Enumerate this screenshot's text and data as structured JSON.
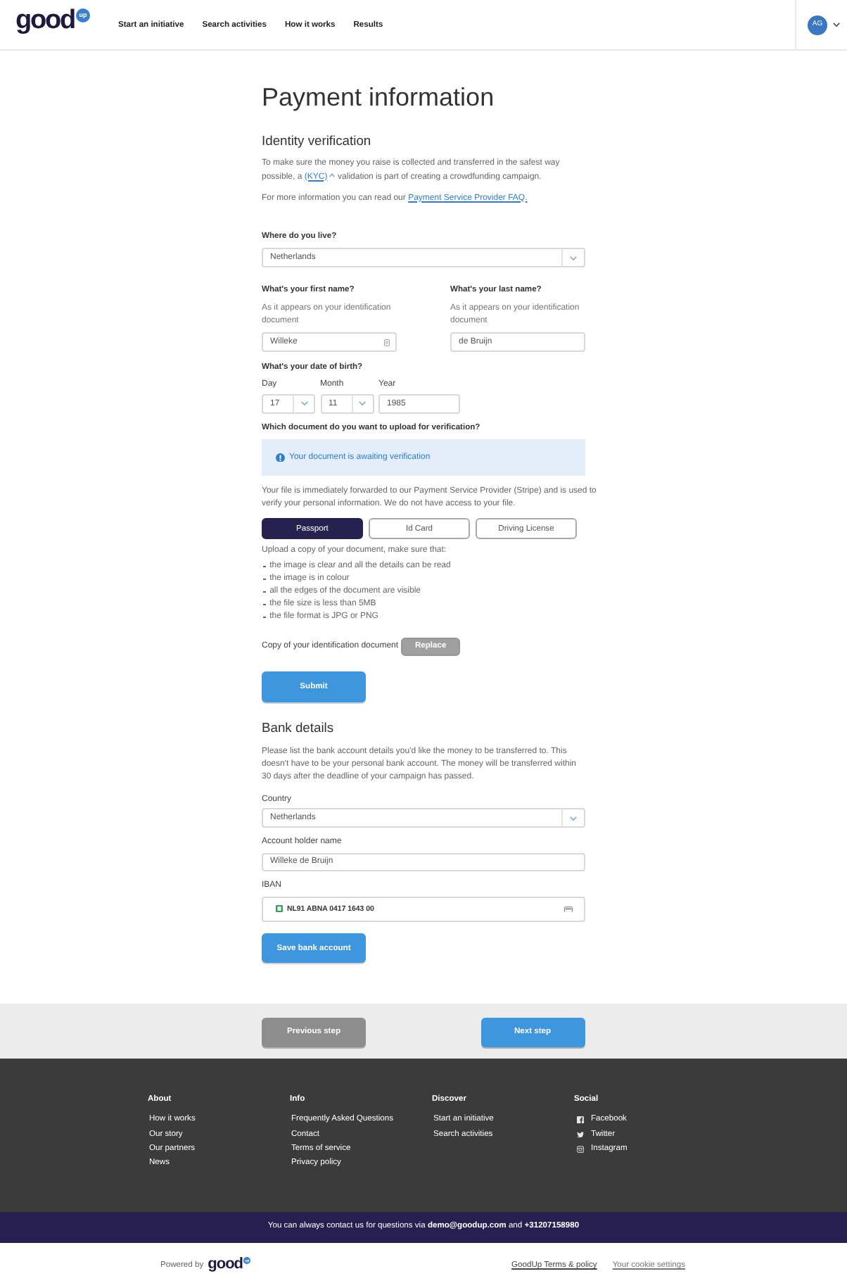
{
  "header": {
    "logo": {
      "word": "good",
      "badge": "up"
    },
    "nav": [
      "Start an initiative",
      "Search activities",
      "How it works",
      "Results"
    ],
    "avatar": "AG"
  },
  "title": "Payment information",
  "identity": {
    "heading": "Identity verification",
    "intro": {
      "before": "To make sure the money you raise is collected and transferred in the safest way possible, a",
      "link": "(KYC)",
      "after": "validation is part of creating a crowdfunding campaign."
    },
    "more_info": {
      "text": "For more information you can read our",
      "link": "Payment Service Provider FAQ."
    },
    "residence": {
      "label": "Where do you live?",
      "value": "Netherlands"
    },
    "names": [
      {
        "label": "What's your first name?",
        "hint": "As it appears on your identification document",
        "value": "Willeke",
        "autofill": true
      },
      {
        "label": "What's your last name?",
        "hint": "As it appears on your identification document",
        "value": "de Bruijn",
        "autofill": false
      }
    ],
    "birth": {
      "label": "What's your date of birth?",
      "parts": [
        {
          "label": "Day",
          "value": "17",
          "kind": "select"
        },
        {
          "label": "Month",
          "value": "11",
          "kind": "select"
        },
        {
          "label": "Year",
          "value": "1985",
          "kind": "text"
        }
      ]
    },
    "document": {
      "question": "Which document do you want to upload for verification?",
      "status": "Your document is awaiting verification",
      "note": "Your file is immediately forwarded to our Payment Service Provider (Stripe) and is used to verify your personal information. We do not have access to your file.",
      "types": [
        {
          "label": "Passport",
          "selected": true
        },
        {
          "label": "Id Card",
          "selected": false
        },
        {
          "label": "Driving License",
          "selected": false
        }
      ],
      "instructions": "Upload a copy of your document, make sure that:",
      "requirements": [
        "the image is clear and all the details can be read",
        "the image is in colour",
        "all the edges of the document are visible",
        "the file size is less than 5MB",
        "the file format is JPG or PNG"
      ],
      "upload": {
        "label": "Copy of your identification document",
        "button": "Replace",
        "disabled": true
      }
    },
    "submit": "Submit"
  },
  "bank": {
    "heading": "Bank details",
    "intro": "Please list the bank account details you'd like the money to be transferred to. This doesn't have to be your personal bank account. The money will be transferred within 30 days after the deadline of your campaign has passed.",
    "fields": [
      {
        "kind": "select",
        "label": "Country",
        "value": "Netherlands"
      },
      {
        "kind": "text",
        "label": "Account holder name",
        "value": "Willeke de Bruijn"
      },
      {
        "kind": "iban",
        "label": "IBAN",
        "value": "NL91 ABNA 0417 1643 00"
      }
    ],
    "save": "Save bank account"
  },
  "steps": [
    {
      "label": "Previous step",
      "kind": "secondary"
    },
    {
      "label": "Next step",
      "kind": "primary"
    }
  ],
  "footer": {
    "columns": [
      {
        "title": "About",
        "kind": "links",
        "links": [
          "How it works",
          "Our story",
          "Our partners",
          "News"
        ]
      },
      {
        "title": "Info",
        "kind": "links",
        "links": [
          "Frequently Asked Questions",
          "Contact",
          "Terms of service",
          "Privacy policy"
        ]
      },
      {
        "title": "Discover",
        "kind": "links",
        "links": [
          "Start an initiative",
          "Search activities"
        ]
      },
      {
        "title": "Social",
        "kind": "social",
        "links": [
          "Facebook",
          "Twitter",
          "Instagram"
        ]
      }
    ]
  },
  "contact": "You can always contact us for questions via **demo@goodup.com** and **+31207158980**",
  "bottom": {
    "powered_by": "Powered by",
    "logo": "good",
    "links": [
      "GoodUp Terms & policy",
      "Your cookie settings"
    ]
  }
}
